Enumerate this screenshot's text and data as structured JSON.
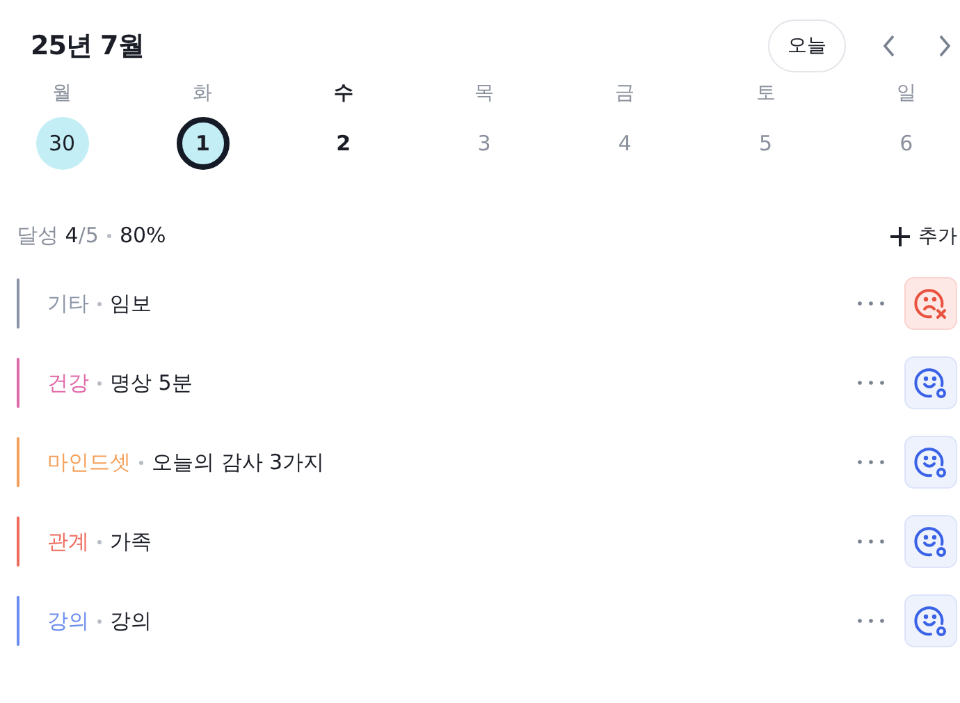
{
  "header": {
    "title": "25년 7월",
    "today_button": "오늘"
  },
  "days": [
    {
      "weekday": "월",
      "date": "30",
      "selected": false,
      "achieved": true,
      "current": false
    },
    {
      "weekday": "화",
      "date": "1",
      "selected": true,
      "achieved": true,
      "current": false
    },
    {
      "weekday": "수",
      "date": "2",
      "selected": false,
      "achieved": false,
      "current": true
    },
    {
      "weekday": "목",
      "date": "3",
      "selected": false,
      "achieved": false,
      "current": false
    },
    {
      "weekday": "금",
      "date": "4",
      "selected": false,
      "achieved": false,
      "current": false
    },
    {
      "weekday": "토",
      "date": "5",
      "selected": false,
      "achieved": false,
      "current": false
    },
    {
      "weekday": "일",
      "date": "6",
      "selected": false,
      "achieved": false,
      "current": false
    }
  ],
  "summary": {
    "label": "달성",
    "done": "4",
    "total": "/5",
    "percent": "80%",
    "add_button": "추가"
  },
  "habits": [
    {
      "category": "기타",
      "color": "#8a94a6",
      "name": "임보",
      "kind": "failed"
    },
    {
      "category": "건강",
      "color": "#e06aa8",
      "name": "명상 5분",
      "kind": "done"
    },
    {
      "category": "마인드셋",
      "color": "#f5a05a",
      "name": "오늘의 감사 3가지",
      "kind": "done"
    },
    {
      "category": "관계",
      "color": "#ef6b5b",
      "name": "가족",
      "kind": "done"
    },
    {
      "category": "강의",
      "color": "#6b8cf0",
      "name": "강의",
      "kind": "done"
    }
  ]
}
